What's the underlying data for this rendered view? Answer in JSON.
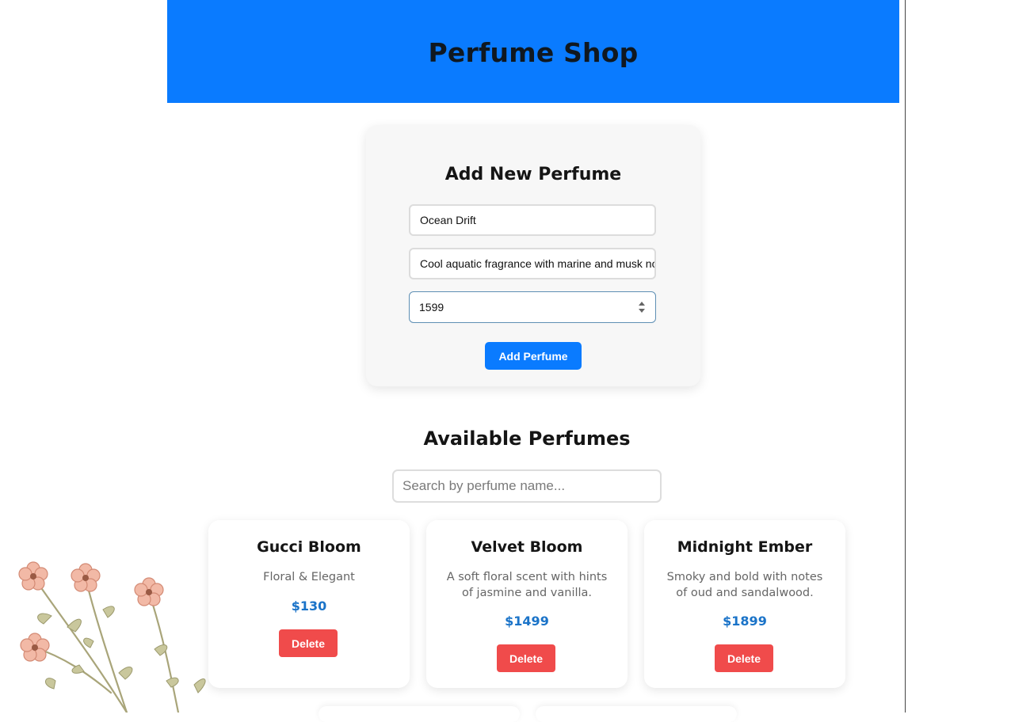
{
  "header": {
    "title": "Perfume Shop"
  },
  "form": {
    "title": "Add New Perfume",
    "name_value": "Ocean Drift",
    "description_value": "Cool aquatic fragrance with marine and musk no",
    "price_value": "1599",
    "submit_label": "Add Perfume"
  },
  "list": {
    "title": "Available Perfumes",
    "search_placeholder": "Search by perfume name...",
    "items": [
      {
        "name": "Gucci Bloom",
        "description": "Floral & Elegant",
        "price": "$130",
        "delete_label": "Delete"
      },
      {
        "name": "Velvet Bloom",
        "description": "A soft floral scent with hints of jasmine and vanilla.",
        "price": "$1499",
        "delete_label": "Delete"
      },
      {
        "name": "Midnight Ember",
        "description": "Smoky and bold with notes of oud and sandalwood.",
        "price": "$1899",
        "delete_label": "Delete"
      }
    ]
  },
  "colors": {
    "header": "#0a7bff",
    "primary_button": "#0a7bff",
    "delete_button": "#f04b4b",
    "price": "#1a73c8"
  },
  "icons": [
    "number-spinner-icon",
    "flower-illustration"
  ]
}
